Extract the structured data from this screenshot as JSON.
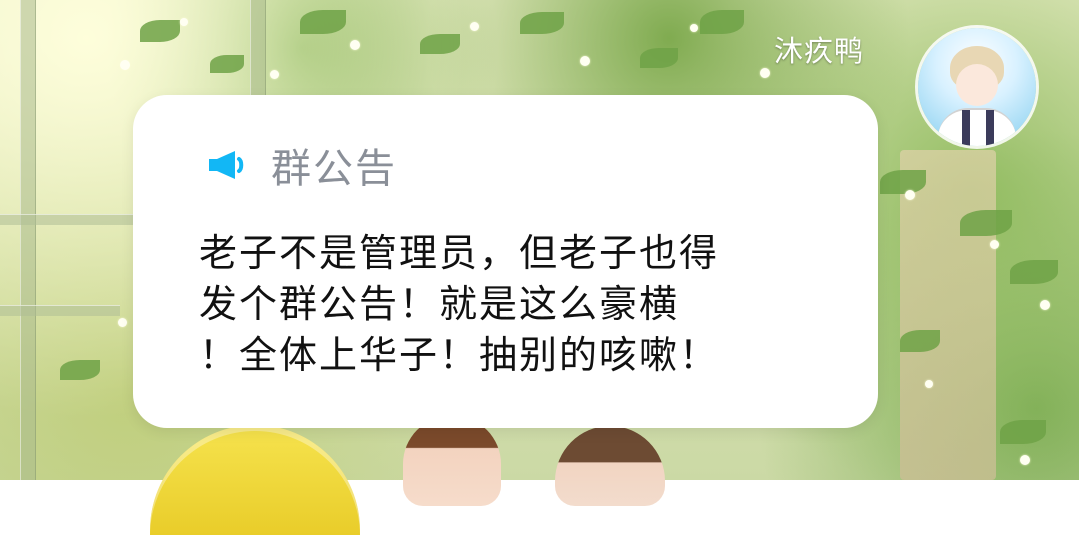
{
  "sender": {
    "name": "沐疚鸭"
  },
  "announcement": {
    "icon": "megaphone-icon",
    "title": "群公告",
    "body_lines": [
      "老子不是管理员，但老子也得",
      "发个群公告！就是这么豪横",
      "！全体上华子！抽别的咳嗽！"
    ]
  },
  "colors": {
    "icon_accent": "#12b7f5",
    "title_gray": "#8a8f98",
    "body_text": "#111111",
    "card_bg": "#ffffff"
  }
}
